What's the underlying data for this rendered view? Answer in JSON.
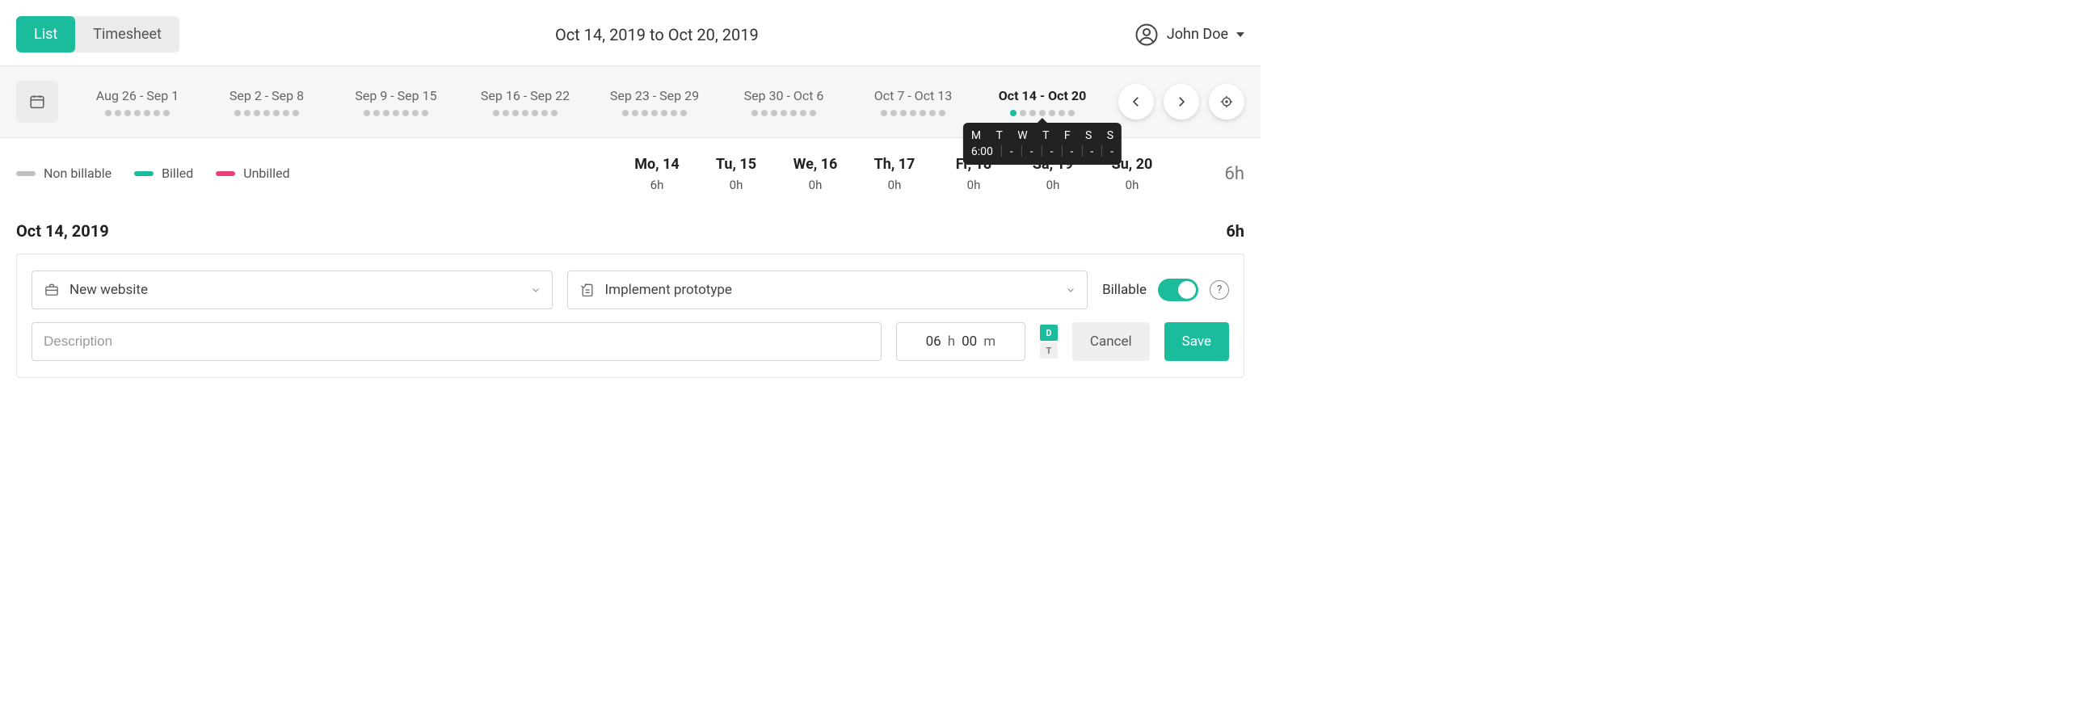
{
  "view_toggle": {
    "list": "List",
    "timesheet": "Timesheet",
    "active": "list"
  },
  "date_range_title": "Oct 14, 2019 to Oct 20, 2019",
  "user": {
    "name": "John Doe"
  },
  "weeks": [
    {
      "label": "Aug 26 - Sep 1",
      "dots": [
        "",
        "",
        "",
        "",
        "",
        "",
        ""
      ]
    },
    {
      "label": "Sep 2 - Sep 8",
      "dots": [
        "",
        "",
        "",
        "",
        "",
        "",
        ""
      ]
    },
    {
      "label": "Sep 9 - Sep 15",
      "dots": [
        "",
        "",
        "",
        "",
        "",
        "",
        ""
      ]
    },
    {
      "label": "Sep 16 - Sep 22",
      "dots": [
        "",
        "",
        "",
        "",
        "",
        "",
        ""
      ]
    },
    {
      "label": "Sep 23 - Sep 29",
      "dots": [
        "",
        "",
        "",
        "",
        "",
        "",
        ""
      ]
    },
    {
      "label": "Sep 30 - Oct 6",
      "dots": [
        "",
        "",
        "",
        "",
        "",
        "",
        ""
      ]
    },
    {
      "label": "Oct 7 - Oct 13",
      "dots": [
        "",
        "",
        "",
        "",
        "",
        "",
        ""
      ]
    },
    {
      "label": "Oct 14 - Oct 20",
      "dots": [
        "teal",
        "",
        "",
        "",
        "",
        "",
        ""
      ],
      "current": true,
      "tooltip": {
        "days": [
          "M",
          "T",
          "W",
          "T",
          "F",
          "S",
          "S"
        ],
        "values": [
          "6:00",
          "-",
          "-",
          "-",
          "-",
          "-",
          "-"
        ]
      }
    }
  ],
  "legend": {
    "non_billable": "Non billable",
    "billed": "Billed",
    "unbilled": "Unbilled"
  },
  "days": [
    {
      "d": "Mo, 14",
      "h": "6h"
    },
    {
      "d": "Tu, 15",
      "h": "0h"
    },
    {
      "d": "We, 16",
      "h": "0h"
    },
    {
      "d": "Th, 17",
      "h": "0h"
    },
    {
      "d": "Fr, 18",
      "h": "0h"
    },
    {
      "d": "Sa, 19",
      "h": "0h"
    },
    {
      "d": "Su, 20",
      "h": "0h"
    }
  ],
  "week_total": "6h",
  "date_heading": {
    "date": "Oct 14, 2019",
    "total": "6h"
  },
  "entry": {
    "project": "New website",
    "task": "Implement prototype",
    "billable_label": "Billable",
    "description_placeholder": "Description",
    "hours": "06",
    "h_unit": "h",
    "minutes": "00",
    "m_unit": "m",
    "dt": {
      "d": "D",
      "t": "T"
    },
    "cancel": "Cancel",
    "save": "Save"
  },
  "help_char": "?"
}
